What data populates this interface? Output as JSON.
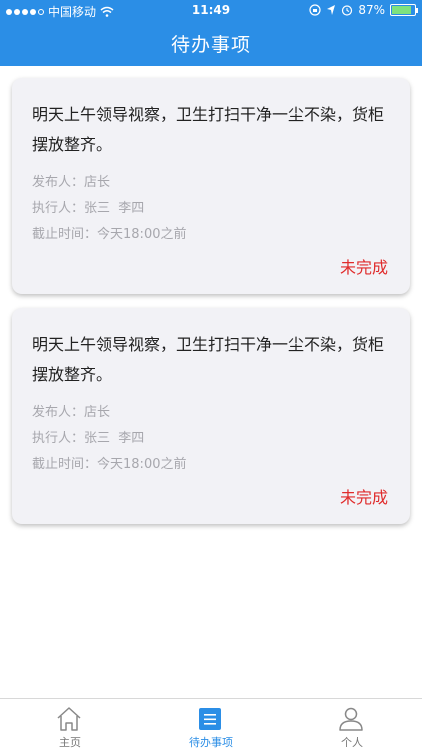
{
  "status_bar": {
    "carrier": "中国移动",
    "time": "11:49",
    "battery_percent": "87%",
    "battery_level": 0.87,
    "icons": [
      "signal-dots-icon",
      "wifi-icon",
      "lock-rotation-icon",
      "location-icon",
      "alarm-icon",
      "battery-icon"
    ]
  },
  "header": {
    "title": "待办事项"
  },
  "tasks": [
    {
      "text": "明天上午领导视察，卫生打扫干净一尘不染，货柜摆放整齐。",
      "publisher_label": "发布人：",
      "publisher": "店长",
      "executor_label": "执行人：",
      "executor": "张三  李四",
      "deadline_label": "截止时间：",
      "deadline": "今天18:00之前",
      "status": "未完成"
    },
    {
      "text": "明天上午领导视察，卫生打扫干净一尘不染，货柜摆放整齐。",
      "publisher_label": "发布人：",
      "publisher": "店长",
      "executor_label": "执行人：",
      "executor": "张三  李四",
      "deadline_label": "截止时间：",
      "deadline": "今天18:00之前",
      "status": "未完成"
    }
  ],
  "tabbar": {
    "items": [
      {
        "label": "主页",
        "icon": "home-icon",
        "active": false
      },
      {
        "label": "待办事项",
        "icon": "todo-list-icon",
        "active": true
      },
      {
        "label": "个人",
        "icon": "user-icon",
        "active": false
      }
    ]
  },
  "colors": {
    "primary": "#2b8ee6",
    "status_incomplete": "#e02b2b",
    "card_bg": "#f2f2f6",
    "meta_text": "#a7a7ad"
  }
}
